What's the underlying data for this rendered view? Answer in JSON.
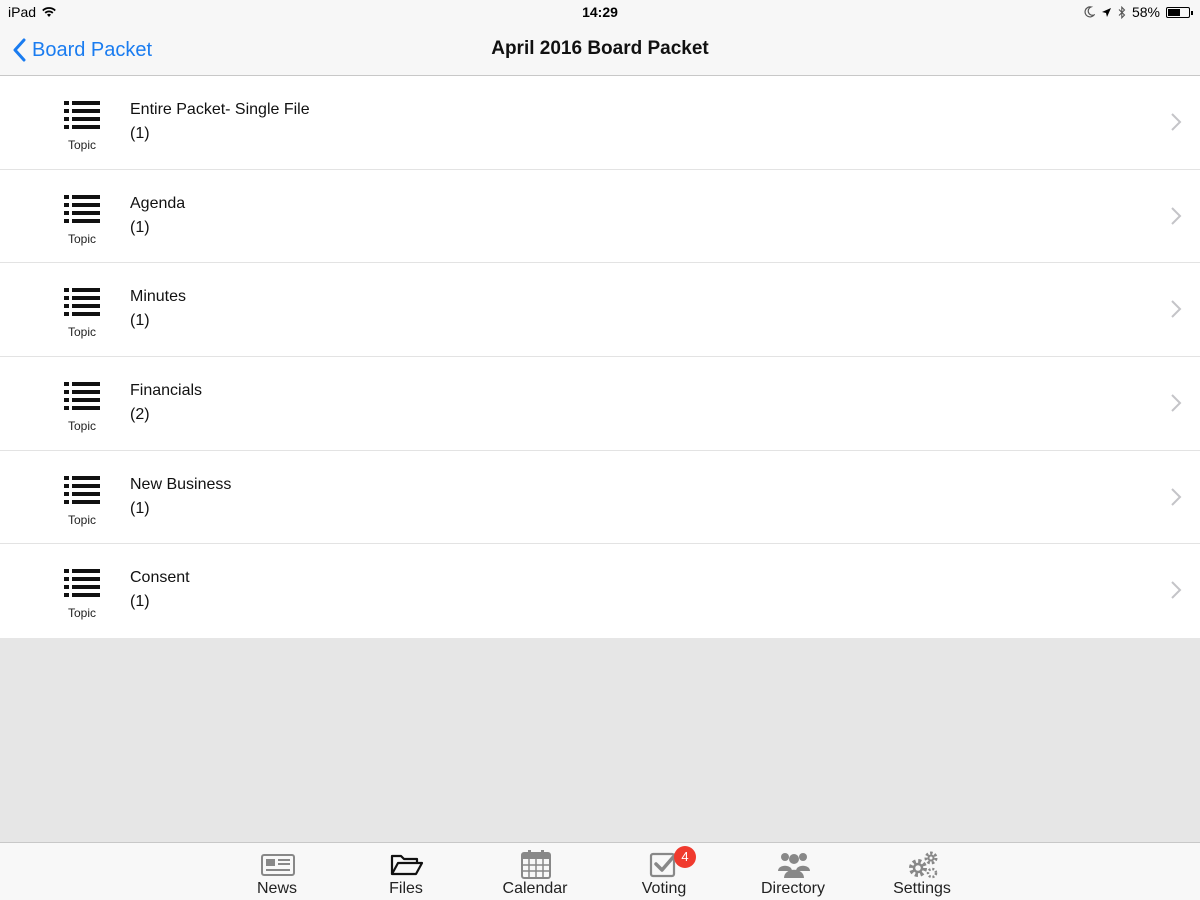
{
  "status_bar": {
    "device": "iPad",
    "time": "14:29",
    "battery": "58%",
    "battery_level": 0.58
  },
  "nav": {
    "back_label": "Board Packet",
    "title": "April 2016 Board Packet"
  },
  "rows": [
    {
      "title": "Entire Packet- Single File",
      "count": "(1)",
      "type_label": "Topic"
    },
    {
      "title": "Agenda",
      "count": "(1)",
      "type_label": "Topic"
    },
    {
      "title": "Minutes",
      "count": "(1)",
      "type_label": "Topic"
    },
    {
      "title": "Financials",
      "count": "(2)",
      "type_label": "Topic"
    },
    {
      "title": "New Business",
      "count": "(1)",
      "type_label": "Topic"
    },
    {
      "title": "Consent",
      "count": "(1)",
      "type_label": "Topic"
    }
  ],
  "tabs": [
    {
      "label": "News",
      "icon": "newspaper-icon"
    },
    {
      "label": "Files",
      "icon": "folder-open-icon"
    },
    {
      "label": "Calendar",
      "icon": "calendar-icon"
    },
    {
      "label": "Voting",
      "icon": "checkbox-icon",
      "badge": "4"
    },
    {
      "label": "Directory",
      "icon": "people-icon"
    },
    {
      "label": "Settings",
      "icon": "gears-icon"
    }
  ],
  "colors": {
    "accent": "#1a7cf0",
    "badge": "#f03a2e",
    "empty_area": "#e6e6e6"
  }
}
